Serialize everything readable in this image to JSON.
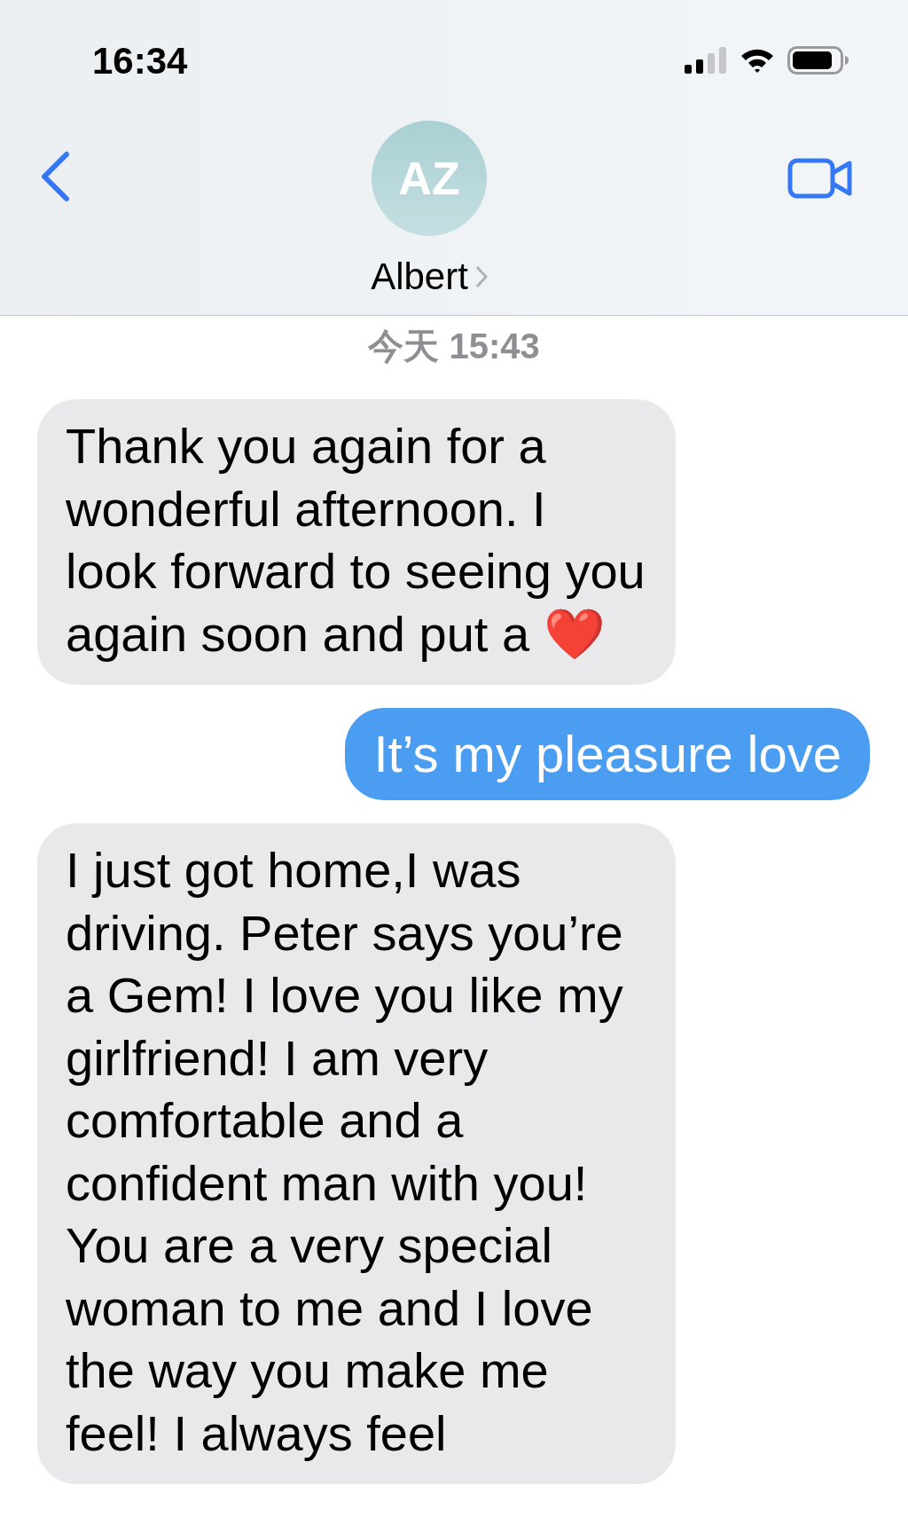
{
  "status_bar": {
    "time": "16:34"
  },
  "header": {
    "avatar_initials": "AZ",
    "contact_name": "Albert"
  },
  "timestamp": "今天 15:43",
  "messages": [
    {
      "sent": false,
      "text": "Thank you again for a wonderful afternoon. I look forward to seeing you again soon and put a ❤️"
    },
    {
      "sent": true,
      "text": "It’s my pleasure love"
    },
    {
      "sent": false,
      "text": "I just got home,I was driving. Peter says you’re a Gem! I love you like my girlfriend! I am very comfortable and a confident man with you! You are a very special woman to me and I love the way you make me feel! I always feel"
    }
  ]
}
